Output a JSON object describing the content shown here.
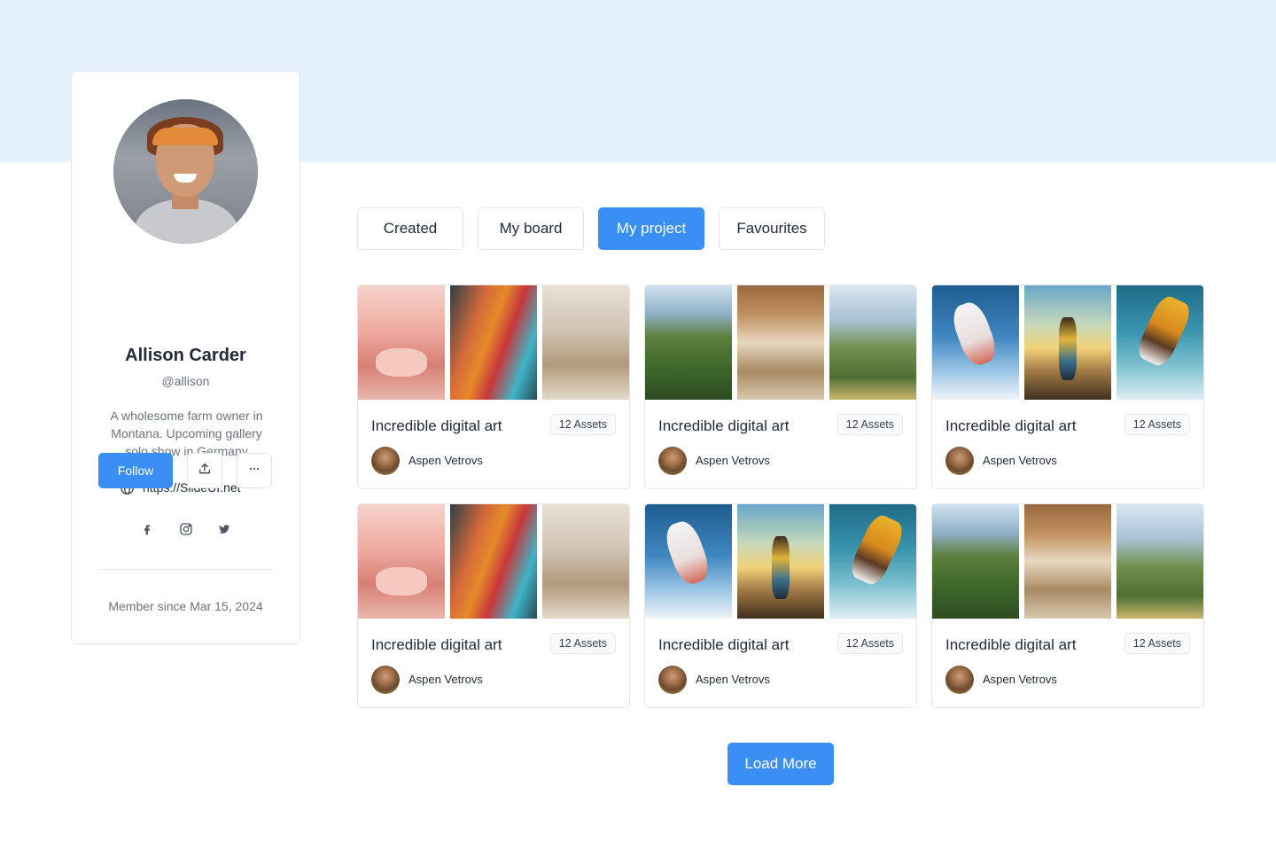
{
  "profile": {
    "name": "Allison Carder",
    "handle": "@allison",
    "bio": "A wholesome farm owner in Montana. Upcoming gallery solo show in Germany",
    "website": "https://SlideUI.net",
    "follow_label": "Follow",
    "member_since": "Member since Mar 15, 2024",
    "social": [
      "facebook-icon",
      "instagram-icon",
      "twitter-icon"
    ]
  },
  "tabs": [
    {
      "label": "Created",
      "active": false
    },
    {
      "label": "My board",
      "active": false
    },
    {
      "label": "My project",
      "active": true
    },
    {
      "label": "Favourites",
      "active": false
    }
  ],
  "cards": [
    {
      "title": "Incredible digital art",
      "assets": "12 Assets",
      "author": "Aspen Vetrovs"
    },
    {
      "title": "Incredible digital art",
      "assets": "12 Assets",
      "author": "Aspen Vetrovs"
    },
    {
      "title": "Incredible digital art",
      "assets": "12 Assets",
      "author": "Aspen Vetrovs"
    },
    {
      "title": "Incredible digital art",
      "assets": "12 Assets",
      "author": "Aspen Vetrovs"
    },
    {
      "title": "Incredible digital art",
      "assets": "12 Assets",
      "author": "Aspen Vetrovs"
    },
    {
      "title": "Incredible digital art",
      "assets": "12 Assets",
      "author": "Aspen Vetrovs"
    }
  ],
  "load_more_label": "Load More",
  "colors": {
    "accent": "#3b8ef3",
    "banner": "#e4f1fd",
    "border": "#e5e7eb"
  }
}
